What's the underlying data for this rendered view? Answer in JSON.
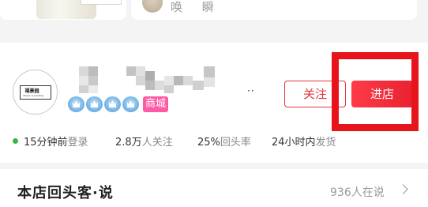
{
  "top": {
    "review_text": "唤  瞬"
  },
  "shop": {
    "logo_text": "福景园",
    "logo_sub": "Flavor & Cooking",
    "badge_icons": [
      "crown-icon",
      "crown-icon",
      "crown-icon",
      "crown-icon"
    ],
    "mall_tag": "商城",
    "ellipsis": "··",
    "follow_label": "关注",
    "enter_label": "进店",
    "accent_color": "#e8333a",
    "highlight_color": "#e8141c"
  },
  "stats": {
    "online_value": "15分钟前",
    "online_label": "登录",
    "followers_value": "2.8万",
    "followers_label": "人关注",
    "return_value": "25%",
    "return_label": "回头率",
    "ship_value": "24小时内",
    "ship_label": "发货"
  },
  "returning": {
    "title": "本店回头客·说",
    "count": "936人在说"
  }
}
